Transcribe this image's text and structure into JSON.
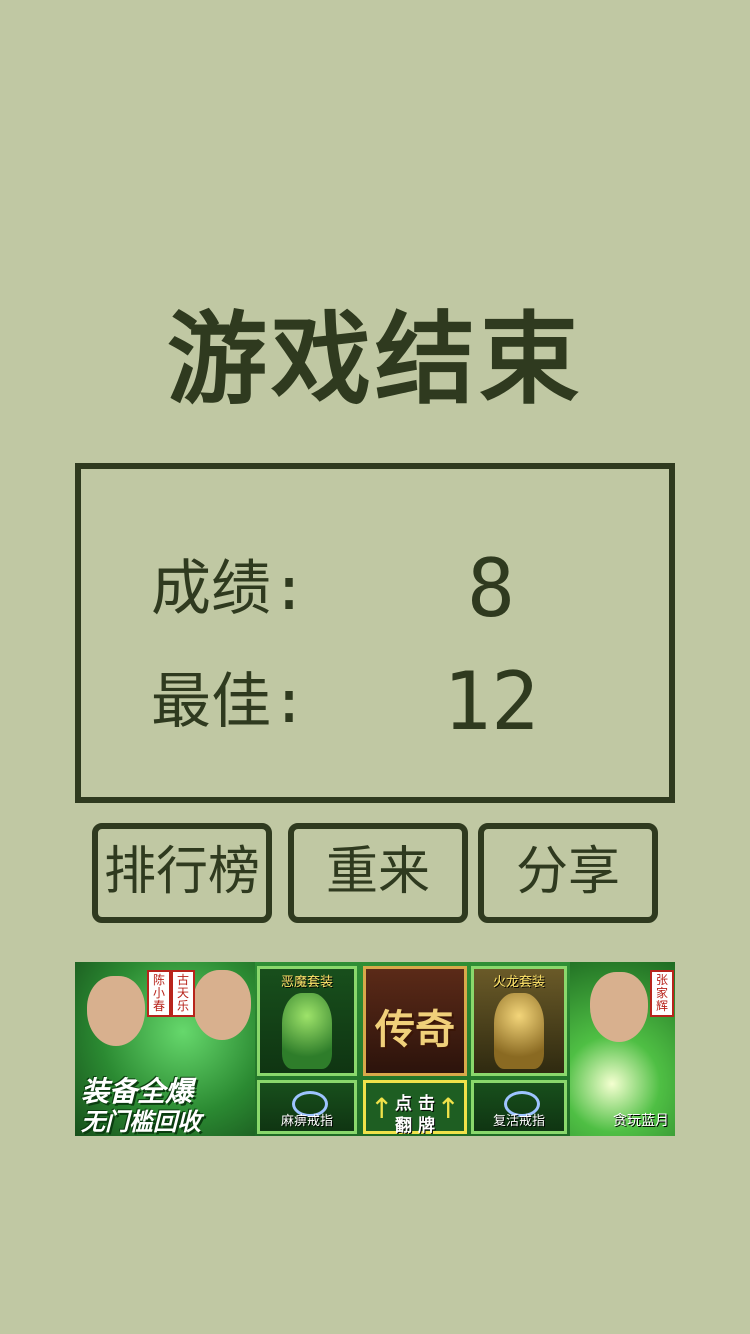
{
  "title": "游戏结束",
  "scores": {
    "score_label": "成绩:",
    "score_value": "8",
    "best_label": "最佳:",
    "best_value": "12"
  },
  "buttons": {
    "rank": "排行榜",
    "restart": "重来",
    "share": "分享"
  },
  "ad": {
    "tag_1": "陈小春",
    "tag_2": "古天乐",
    "tag_3": "张家辉",
    "slogan_1": "装备全爆",
    "slogan_2": "无门槛回收",
    "tile_a_label": "恶魔套装",
    "tile_b_text": "传奇",
    "tile_c_label": "火龙套装",
    "tile_d_label": "麻痹戒指",
    "tile_e_line1": "点 击",
    "tile_e_line2": "翻 牌",
    "tile_f_label": "复活戒指",
    "brand": "贪玩蓝月"
  },
  "colors": {
    "background": "#c0c8a3",
    "foreground": "#2f3a1f"
  }
}
